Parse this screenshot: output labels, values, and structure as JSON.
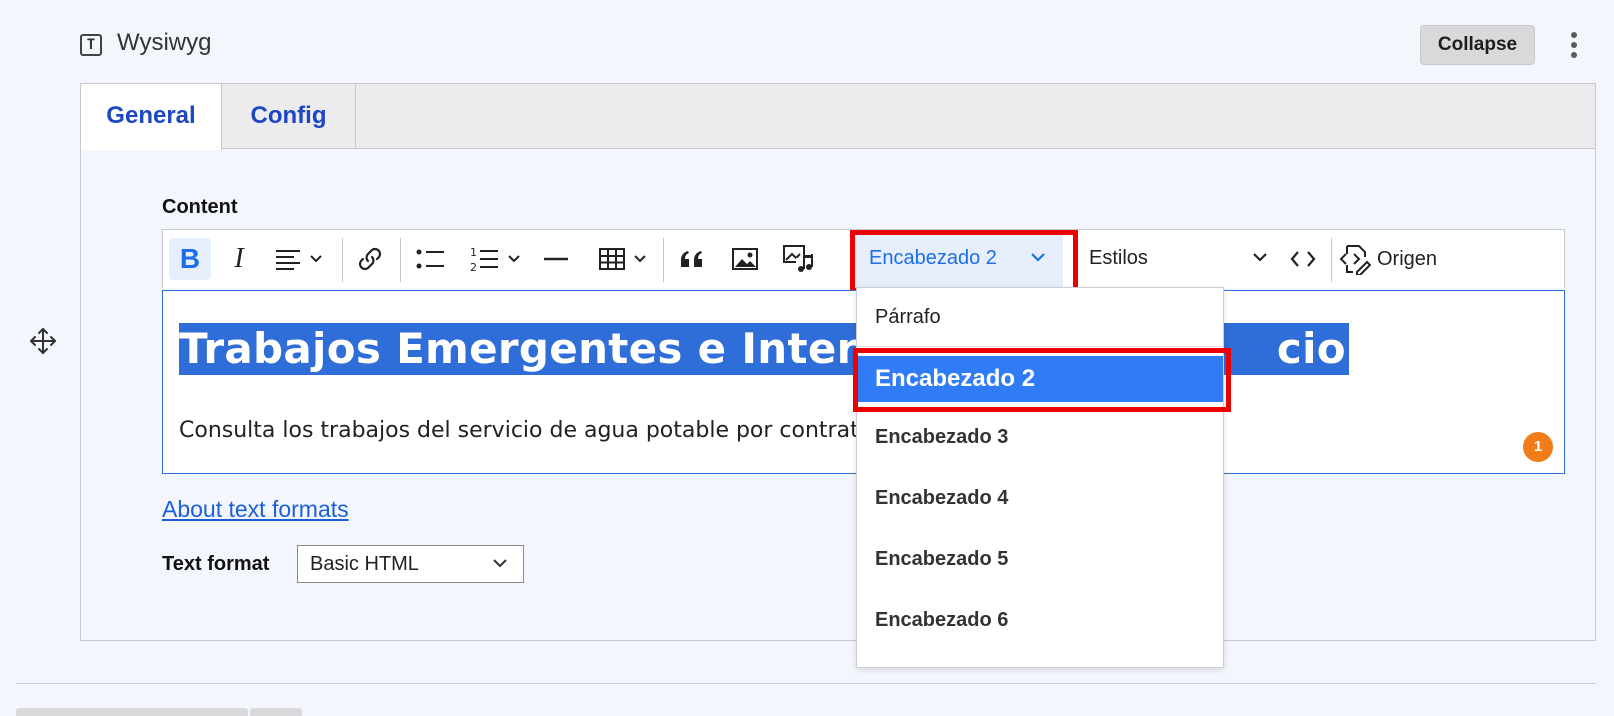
{
  "block": {
    "type_icon_glyph": "T",
    "title": "Wysiwyg",
    "collapse_label": "Collapse"
  },
  "tabs": [
    {
      "label": "General",
      "active": true
    },
    {
      "label": "Config",
      "active": false
    }
  ],
  "field": {
    "label": "Content"
  },
  "toolbar": {
    "bold_glyph": "B",
    "italic_glyph": "I",
    "icons": [
      "bold-icon",
      "italic-icon",
      "align-icon",
      "link-icon",
      "bullet-list-icon",
      "numbered-list-icon",
      "horizontal-line-icon",
      "table-icon",
      "blockquote-icon",
      "image-icon",
      "media-icon",
      "source-editing-icon"
    ],
    "heading_value": "Encabezado 2",
    "styles_value": "Estilos",
    "source_label": "Origen"
  },
  "editor": {
    "heading_text": "Trabajos Emergentes e Interrupciones del Servicio",
    "heading_visible_left": "Trabajos Emergentes e Interru",
    "heading_visible_right": "cio",
    "paragraph_visible": "Consulta los trabajos del servicio de agua potable por contrat",
    "badge_count": "1"
  },
  "heading_dropdown": {
    "options": [
      {
        "label": "Párrafo"
      },
      {
        "label": "Encabezado 2",
        "selected": true
      },
      {
        "label": "Encabezado 3"
      },
      {
        "label": "Encabezado 4"
      },
      {
        "label": "Encabezado 5"
      },
      {
        "label": "Encabezado 6"
      }
    ]
  },
  "about_link": "About text formats",
  "text_format": {
    "label": "Text format",
    "value": "Basic HTML"
  },
  "colors": {
    "accent": "#1c6fe8",
    "selection": "#2f6dd8",
    "highlight_box": "#ec0000",
    "badge": "#f07c1a"
  }
}
